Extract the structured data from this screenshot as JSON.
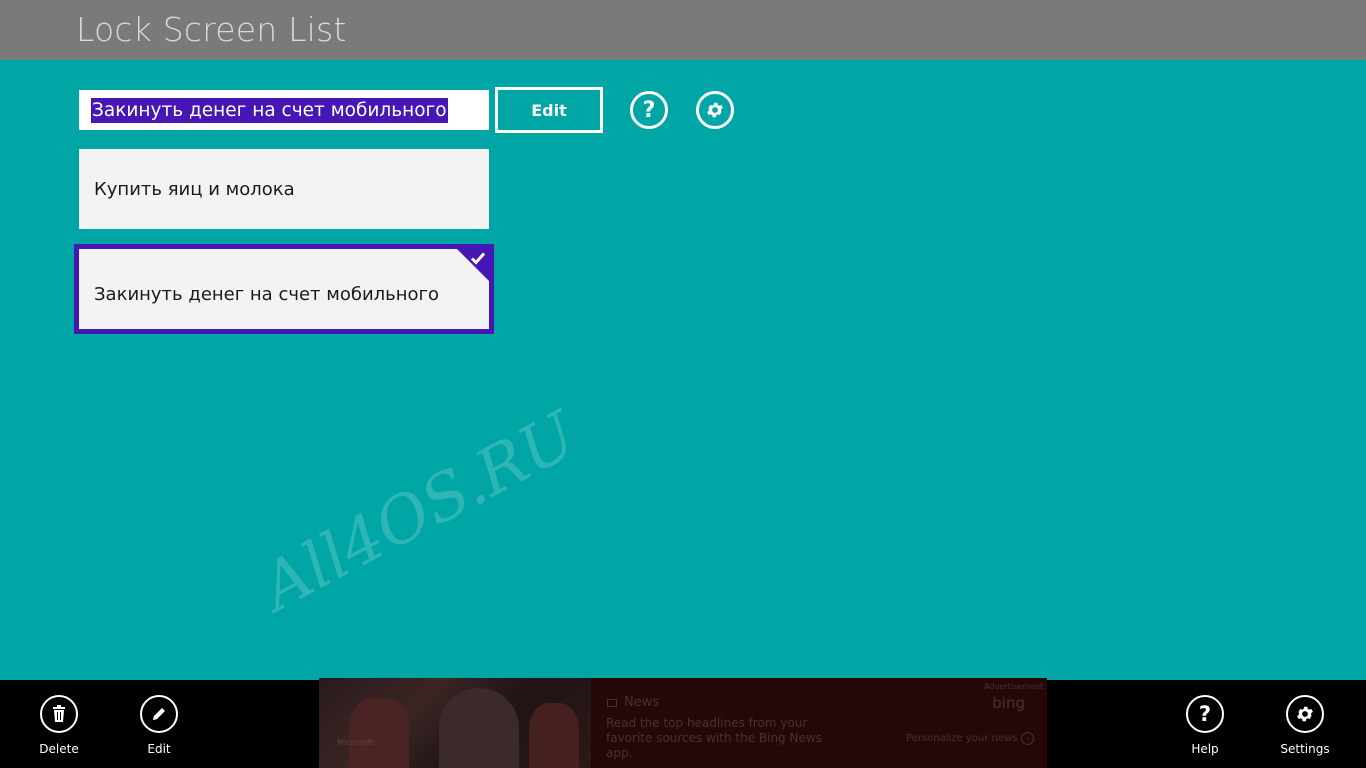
{
  "app": {
    "title": "Lock Screen List"
  },
  "editor": {
    "input_value": "Закинуть денег на счет мобильного",
    "edit_label": "Edit"
  },
  "items": [
    {
      "label": "Купить яиц и молока",
      "selected": false
    },
    {
      "label": "Закинуть денег на счет мобильного",
      "selected": true
    }
  ],
  "watermark": "All4OS.RU",
  "appbar": {
    "delete_label": "Delete",
    "edit_label": "Edit",
    "help_label": "Help",
    "settings_label": "Settings"
  },
  "ad": {
    "advertisement_label": "Advertisement",
    "brand": "bing",
    "news_title": "News",
    "text": "Read the top headlines from your favorite sources with the Bing News app.",
    "link": "Personalize your news",
    "image_brand": "Microsoft"
  },
  "colors": {
    "background": "#00a6a6",
    "titlebar": "#7a7a7a",
    "accent": "#4617b4",
    "appbar": "#000000"
  },
  "icons": {
    "help": "help-icon",
    "settings": "gear-icon",
    "delete": "trash-icon",
    "edit": "pencil-icon",
    "check": "check-icon"
  }
}
